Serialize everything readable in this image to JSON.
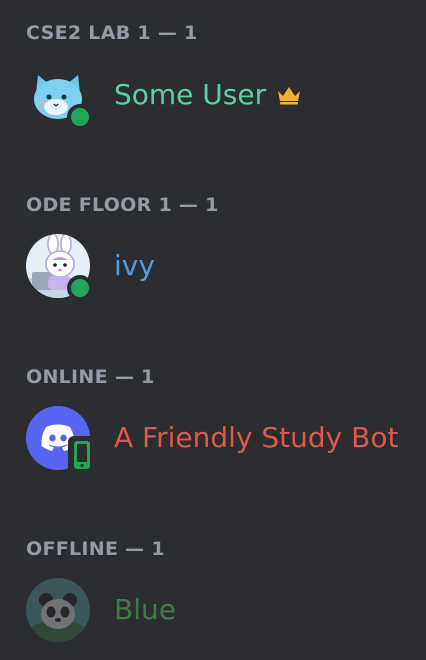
{
  "groups": [
    {
      "header": "CSE2 LAB 1 — 1",
      "members": [
        {
          "name": "Some User",
          "name_color": "#5ccfa0",
          "status": "online",
          "owner": true,
          "avatar_icon": "cat-avatar"
        }
      ]
    },
    {
      "header": "ODE FLOOR 1 — 1",
      "members": [
        {
          "name": "ivy",
          "name_color": "#4e9de2",
          "status": "online",
          "owner": false,
          "avatar_icon": "bunny-avatar"
        }
      ]
    },
    {
      "header": "ONLINE — 1",
      "members": [
        {
          "name": "A Friendly Study Bot",
          "name_color": "#e0584a",
          "status": "mobile",
          "owner": false,
          "avatar_icon": "discord-avatar"
        }
      ]
    },
    {
      "header": "OFFLINE — 1",
      "members": [
        {
          "name": "Blue",
          "name_color": "#3f7a4a",
          "status": "offline",
          "owner": false,
          "avatar_icon": "panda-avatar"
        }
      ]
    }
  ],
  "colors": {
    "background": "#2b2d31",
    "header_text": "#949ba4",
    "online_status": "#23a55a",
    "crown": "#f0b232",
    "discord_blurple": "#5865f2"
  }
}
